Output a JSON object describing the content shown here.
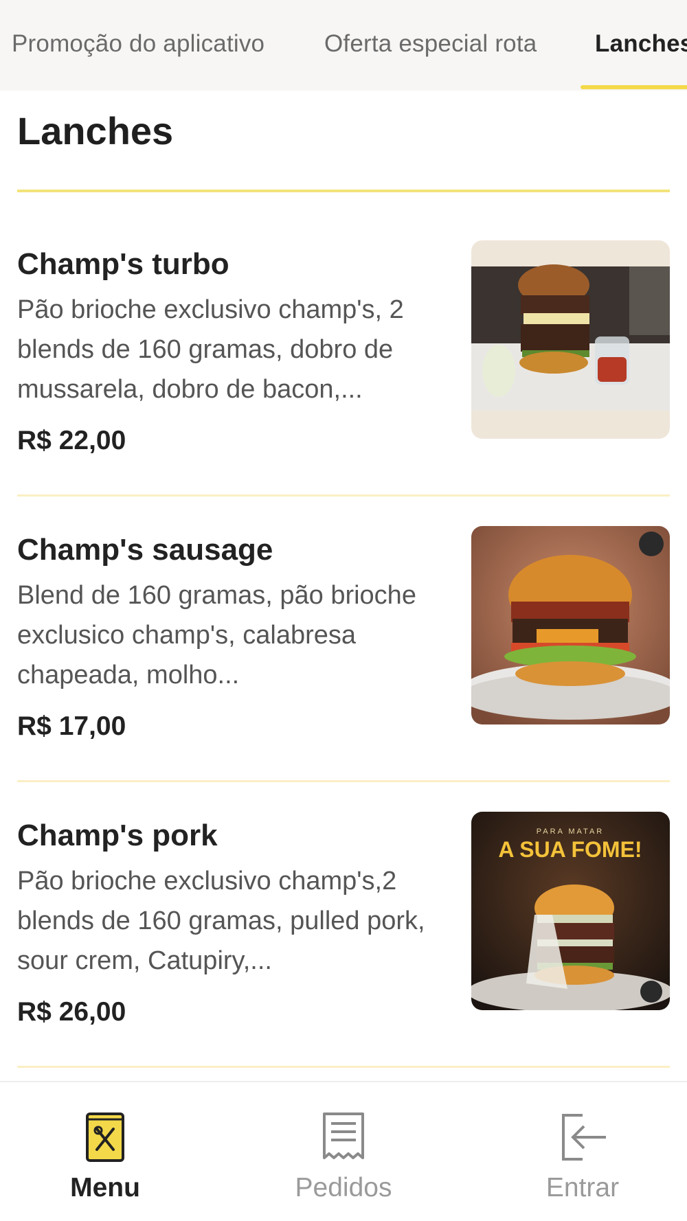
{
  "tabs": [
    {
      "label": "Promoção do aplicativo",
      "active": false
    },
    {
      "label": "Oferta especial rota",
      "active": false
    },
    {
      "label": "Lanches",
      "active": true
    }
  ],
  "section": {
    "title": "Lanches"
  },
  "products": [
    {
      "name": "Champ's turbo",
      "description": "Pão brioche exclusivo champ's, 2 blends de 160 gramas, dobro de mussarela, dobro de bacon,...",
      "price": "R$ 22,00"
    },
    {
      "name": "Champ's sausage",
      "description": "Blend de 160 gramas, pão brioche exclusico champ's, calabresa chapeada, molho...",
      "price": "R$ 17,00"
    },
    {
      "name": "Champ's pork",
      "description": "Pão brioche exclusivo champ's,2 blends de 160 gramas, pulled pork, sour crem, Catupiry,...",
      "price": "R$ 26,00",
      "image_text": {
        "small": "PARA MATAR",
        "big": "A SUA FOME!"
      }
    }
  ],
  "bottom_nav": [
    {
      "label": "Menu",
      "icon": "menu-book-icon",
      "active": true
    },
    {
      "label": "Pedidos",
      "icon": "receipt-icon",
      "active": false
    },
    {
      "label": "Entrar",
      "icon": "login-icon",
      "active": false
    }
  ],
  "colors": {
    "accent": "#f3d94a",
    "accent_light": "#faefc4",
    "text": "#222222",
    "muted": "#9a9a9a"
  }
}
